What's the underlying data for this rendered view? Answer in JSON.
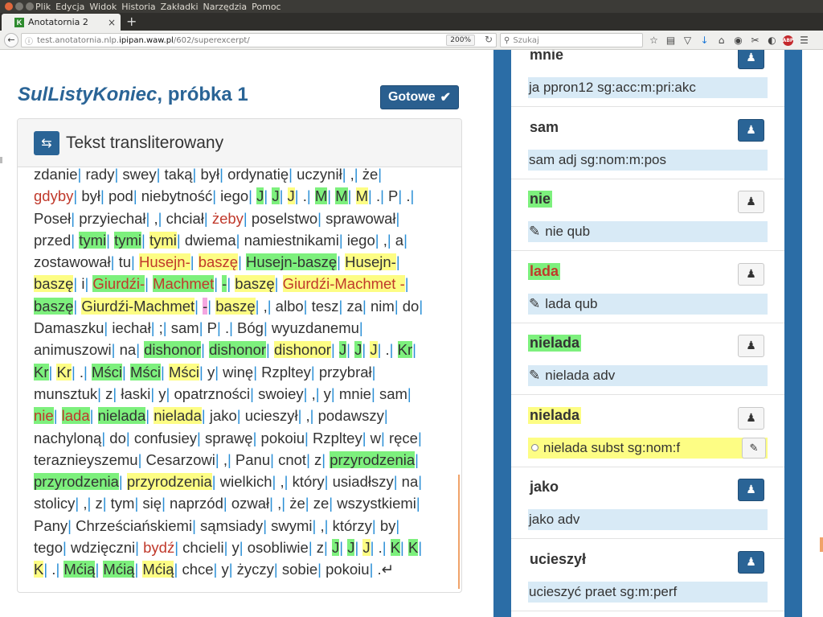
{
  "os_menu": [
    "Plik",
    "Edycja",
    "Widok",
    "Historia",
    "Zakładki",
    "Narzędzia",
    "Pomoc"
  ],
  "tab": {
    "favicon": "K",
    "title": "Anotatornia 2",
    "close": "×",
    "new_tab": "+"
  },
  "url": {
    "rest_prefix": "test.anotatornia.nlp.",
    "host": "ipipan.waw.pl",
    "rest_suffix": "/602/superexcerpt/",
    "zoom": "200%"
  },
  "search": {
    "placeholder": "Szukaj"
  },
  "page": {
    "title_italic": "SulListyKoniec",
    "title_mid": ", próbka ",
    "title_num": "1",
    "done_label": "Gotowe",
    "panel_title": "Tekst transliterowany"
  },
  "colors": {
    "accent": "#2a6496",
    "green_hl": "#7df07d",
    "yellow_hl": "#fdfd84",
    "frame": "#2b6da6"
  },
  "text_lines": [
    [
      [
        "zdanie",
        ""
      ],
      [
        "rady",
        ""
      ],
      [
        "swey",
        ""
      ],
      [
        "taką",
        ""
      ],
      [
        "był",
        ""
      ],
      [
        "ordynatię",
        ""
      ],
      [
        "uczynił",
        ""
      ],
      [
        ",",
        ""
      ],
      [
        "że",
        ""
      ]
    ],
    [
      [
        "gdyby",
        "r"
      ],
      [
        "był",
        ""
      ],
      [
        "pod",
        ""
      ],
      [
        "niebytność",
        ""
      ],
      [
        "iego",
        ""
      ],
      [
        "J",
        "g"
      ],
      [
        "J",
        "g"
      ],
      [
        "J",
        "y"
      ],
      [
        ".",
        ""
      ],
      [
        "M",
        "g"
      ],
      [
        "M",
        "g"
      ],
      [
        "M",
        "y"
      ],
      [
        ".",
        ""
      ],
      [
        "P",
        ""
      ],
      [
        ".",
        ""
      ]
    ],
    [
      [
        "Poseł",
        ""
      ],
      [
        "przyiechał",
        ""
      ],
      [
        ",",
        ""
      ],
      [
        "chciał",
        ""
      ],
      [
        "żeby",
        "r"
      ],
      [
        "poselstwo",
        ""
      ],
      [
        "sprawował",
        ""
      ]
    ],
    [
      [
        "przed",
        ""
      ],
      [
        "tymi",
        "g"
      ],
      [
        "tymi",
        "g"
      ],
      [
        "tymi",
        "y"
      ],
      [
        "dwiema",
        ""
      ],
      [
        "namiestnikami",
        ""
      ],
      [
        "iego",
        ""
      ],
      [
        ",",
        ""
      ],
      [
        "a",
        ""
      ]
    ],
    [
      [
        "zostawował",
        ""
      ],
      [
        "tu",
        ""
      ],
      [
        "Husejn-",
        "yr"
      ],
      [
        "baszę",
        "yr"
      ],
      [
        "Husejn-baszę",
        "g"
      ],
      [
        "Husejn-",
        "y"
      ]
    ],
    [
      [
        "baszę",
        "y"
      ],
      [
        "i",
        ""
      ],
      [
        "Giurdźi-",
        "gr"
      ],
      [
        "Machmet",
        "gr"
      ],
      [
        "-",
        "g"
      ],
      [
        "baszę",
        "y"
      ],
      [
        "Giurdźi-Machmet -",
        "yr"
      ]
    ],
    [
      [
        "baszę",
        "g"
      ],
      [
        "Giurdźi-Machmet",
        "y"
      ],
      [
        "-",
        "p"
      ],
      [
        "baszę",
        "y"
      ],
      [
        ",",
        ""
      ],
      [
        "albo",
        ""
      ],
      [
        "tesz",
        ""
      ],
      [
        "za",
        ""
      ],
      [
        "nim",
        ""
      ],
      [
        "do",
        ""
      ]
    ],
    [
      [
        "Damaszku",
        ""
      ],
      [
        "iechał",
        ""
      ],
      [
        ";",
        ""
      ],
      [
        "sam",
        ""
      ],
      [
        "P",
        ""
      ],
      [
        ".",
        ""
      ],
      [
        "Bóg",
        ""
      ],
      [
        "wyuzdanemu",
        ""
      ]
    ],
    [
      [
        "animuszowi",
        ""
      ],
      [
        "na",
        ""
      ],
      [
        "dishonor",
        "g"
      ],
      [
        "dishonor",
        "g"
      ],
      [
        "dishonor",
        "y"
      ],
      [
        "J",
        "g"
      ],
      [
        "J",
        "g"
      ],
      [
        "J",
        "y"
      ],
      [
        ".",
        ""
      ],
      [
        "Kr",
        "g"
      ]
    ],
    [
      [
        "Kr",
        "g"
      ],
      [
        "Kr",
        "y"
      ],
      [
        ".",
        ""
      ],
      [
        "Mści",
        "g"
      ],
      [
        "Mści",
        "g"
      ],
      [
        "Mści",
        "y"
      ],
      [
        "y",
        ""
      ],
      [
        "winę",
        ""
      ],
      [
        "Rzpltey",
        ""
      ],
      [
        "przybrał",
        ""
      ]
    ],
    [
      [
        "munsztuk",
        ""
      ],
      [
        "z",
        ""
      ],
      [
        "łaski",
        ""
      ],
      [
        "y",
        ""
      ],
      [
        "opatrzności",
        ""
      ],
      [
        "swoiey",
        ""
      ],
      [
        ",",
        ""
      ],
      [
        "y",
        ""
      ],
      [
        "mnie",
        ""
      ],
      [
        "sam",
        ""
      ]
    ],
    [
      [
        "nie",
        "gr"
      ],
      [
        "lada",
        "gr"
      ],
      [
        "nielada",
        "g"
      ],
      [
        "nielada",
        "y"
      ],
      [
        "jako",
        ""
      ],
      [
        "ucieszył",
        ""
      ],
      [
        ",",
        ""
      ],
      [
        "podawszy",
        ""
      ]
    ],
    [
      [
        "nachyloną",
        ""
      ],
      [
        "do",
        ""
      ],
      [
        "confusiey",
        ""
      ],
      [
        "sprawę",
        ""
      ],
      [
        "pokoiu",
        ""
      ],
      [
        "Rzpltey",
        ""
      ],
      [
        "w",
        ""
      ],
      [
        "ręce",
        ""
      ]
    ],
    [
      [
        "teraznieyszemu",
        ""
      ],
      [
        "Cesarzowi",
        ""
      ],
      [
        ",",
        ""
      ],
      [
        "Panu",
        ""
      ],
      [
        "cnot",
        ""
      ],
      [
        "z",
        ""
      ],
      [
        "przyrodzenia",
        "g"
      ]
    ],
    [
      [
        "przyrodzenia",
        "g"
      ],
      [
        "przyrodzenia",
        "y"
      ],
      [
        "wielkich",
        ""
      ],
      [
        ",",
        ""
      ],
      [
        "który",
        ""
      ],
      [
        "usiadłszy",
        ""
      ],
      [
        "na",
        ""
      ]
    ],
    [
      [
        "stolicy",
        ""
      ],
      [
        ",",
        ""
      ],
      [
        "z",
        ""
      ],
      [
        "tym",
        ""
      ],
      [
        "się",
        ""
      ],
      [
        "naprzód",
        ""
      ],
      [
        "ozwał",
        ""
      ],
      [
        ",",
        ""
      ],
      [
        "że",
        ""
      ],
      [
        "ze",
        ""
      ],
      [
        "wszystkiemi",
        ""
      ]
    ],
    [
      [
        "Pany",
        ""
      ],
      [
        "Chrześciańskiemi",
        ""
      ],
      [
        "sąmsiady",
        ""
      ],
      [
        "swymi",
        ""
      ],
      [
        ",",
        ""
      ],
      [
        "którzy",
        ""
      ],
      [
        "by",
        ""
      ]
    ],
    [
      [
        "tego",
        ""
      ],
      [
        "wdzięczni",
        ""
      ],
      [
        "bydź",
        "r"
      ],
      [
        "chcieli",
        ""
      ],
      [
        "y",
        ""
      ],
      [
        "osobliwie",
        ""
      ],
      [
        "z",
        ""
      ],
      [
        "J",
        "g"
      ],
      [
        "J",
        "g"
      ],
      [
        "J",
        "y"
      ],
      [
        ".",
        ""
      ],
      [
        "K",
        "g"
      ],
      [
        "K",
        "g"
      ]
    ],
    [
      [
        "K",
        "y"
      ],
      [
        ".",
        ""
      ],
      [
        "Mćią",
        "g"
      ],
      [
        "Mćią",
        "g"
      ],
      [
        "Mćią",
        "y"
      ],
      [
        "chce",
        ""
      ],
      [
        "y",
        ""
      ],
      [
        "życzy",
        ""
      ],
      [
        "sobie",
        ""
      ],
      [
        "pokoiu",
        ""
      ],
      [
        ".↵",
        "end"
      ]
    ]
  ],
  "cards": [
    {
      "word": "mnie",
      "hl": "",
      "button": "blue",
      "interp": "ja ppron12 sg:acc:m:pri:akc",
      "mode": "plain"
    },
    {
      "word": "sam",
      "hl": "",
      "button": "blue",
      "interp": "sam adj sg:nom:m:pos",
      "mode": "plain"
    },
    {
      "word": "nie",
      "hl": "g",
      "button": "white",
      "interp": "nie qub",
      "mode": "pen"
    },
    {
      "word": "lada",
      "hl": "gr",
      "button": "white",
      "interp": "lada qub",
      "mode": "pen"
    },
    {
      "word": "nielada",
      "hl": "g",
      "button": "white",
      "interp": "nielada adv",
      "mode": "pen"
    },
    {
      "word": "nielada",
      "hl": "y",
      "button": "white",
      "interp": "nielada subst sg:nom:f",
      "mode": "radio"
    },
    {
      "word": "jako",
      "hl": "",
      "button": "blue",
      "interp": "jako adv",
      "mode": "plain"
    },
    {
      "word": "ucieszył",
      "hl": "",
      "button": "blue",
      "interp": "ucieszyć praet sg:m:perf",
      "mode": "plain"
    }
  ],
  "icons": {
    "back": "back-arrow-icon",
    "info": "info-icon",
    "reload": "reload-icon",
    "search": "search-icon",
    "swap": "swap-arrows-icon",
    "check": "check-icon",
    "chess": "chess-pawn-icon",
    "pen": "pencil-icon"
  }
}
